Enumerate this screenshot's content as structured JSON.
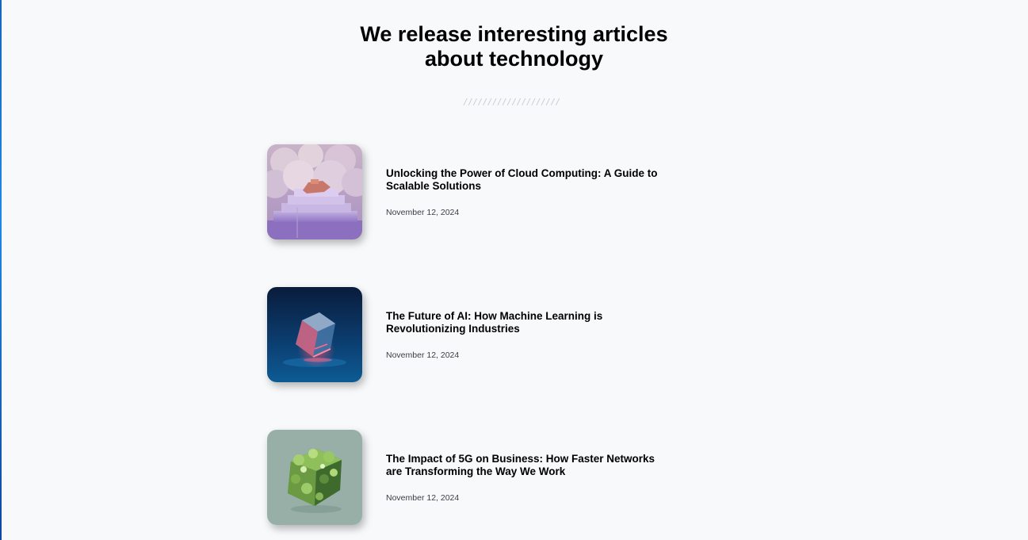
{
  "header": {
    "title_line1": "We release interesting articles",
    "title_line2": "about technology",
    "divider": "////////////////////"
  },
  "articles": [
    {
      "title": "Unlocking the Power of Cloud Computing: A Guide to Scalable Solutions",
      "date": "November 12, 2024",
      "image": "cloud-staircase-render"
    },
    {
      "title": "The Future of AI: How Machine Learning is Revolutionizing Industries",
      "date": "November 12, 2024",
      "image": "glowing-glass-cube-render"
    },
    {
      "title": "The Impact of 5G on Business: How Faster Networks are Transforming the Way We Work",
      "date": "November 12, 2024",
      "image": "green-moss-cube-render"
    }
  ],
  "colors": {
    "background": "#f7f9fb",
    "text": "#000000",
    "date_text": "#3a3f45",
    "divider": "#c8cdd4"
  }
}
